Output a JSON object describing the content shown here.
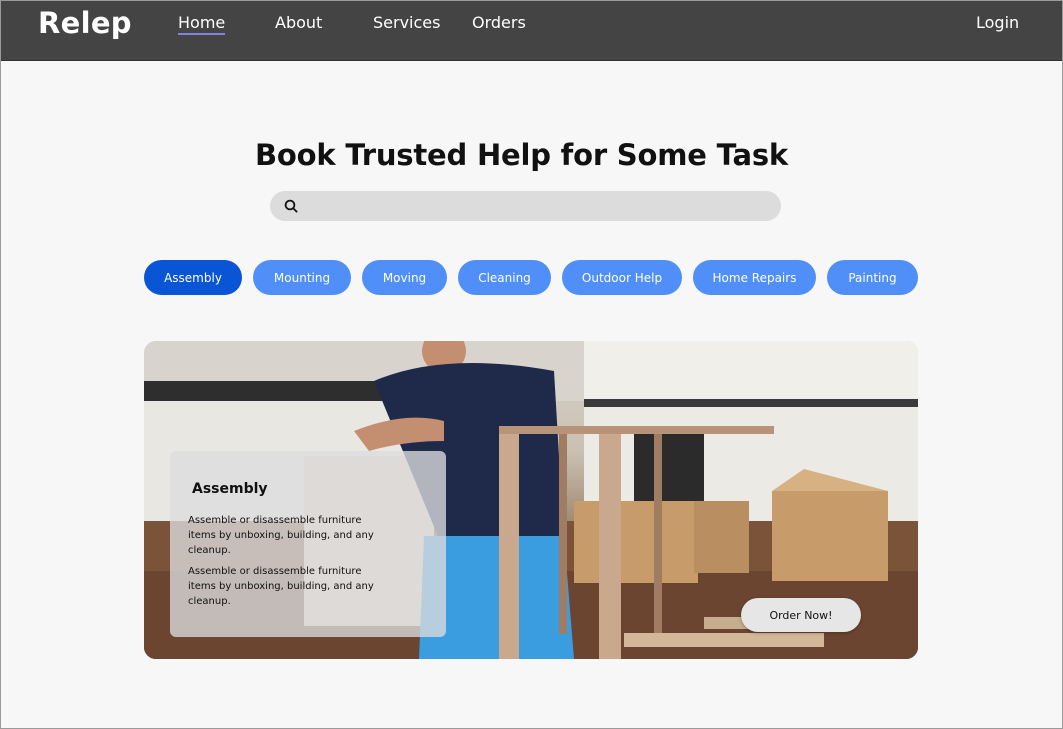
{
  "nav": {
    "brand": "Relep",
    "links": [
      "Home",
      "About",
      "Services",
      "Orders"
    ],
    "active": "Home",
    "login": "Login"
  },
  "hero": {
    "title": "Book Trusted Help for Some Task",
    "search_value": "",
    "search_placeholder": ""
  },
  "categories": [
    "Assembly",
    "Mounting",
    "Moving",
    "Cleaning",
    "Outdoor Help",
    "Home Repairs",
    "Painting"
  ],
  "selected_category": "Assembly",
  "featured": {
    "title": "Assembly",
    "description_1": "Assemble or disassemble furniture items by unboxing, building, and any cleanup.",
    "description_2": "Assemble or disassemble furniture items by unboxing, building, and any cleanup.",
    "cta": "Order Now!"
  },
  "colors": {
    "nav_bg": "#444444",
    "pill": "#4f8ff7",
    "pill_active": "#0a55d6",
    "page_bg": "#f7f7f7"
  },
  "icons": {
    "search": "search-icon"
  }
}
